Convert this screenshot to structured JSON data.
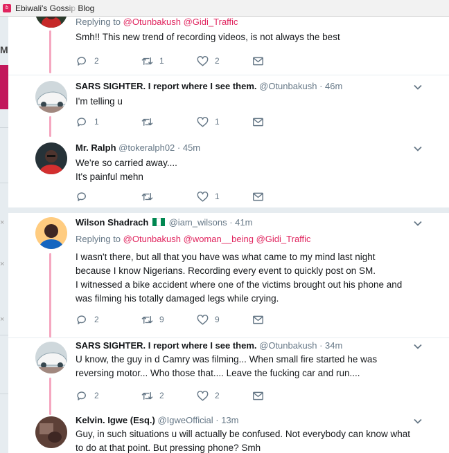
{
  "browser": {
    "tab_title": "Ebiwali's Gossip Blog"
  },
  "left_strip": {
    "letter": "M",
    "close_glyph": "×"
  },
  "tweets": [
    {
      "replying_label": "Replying to",
      "mentions": [
        "@Otunbakush",
        "@Gidi_Traffic"
      ],
      "text": [
        "Smh!! This new trend of recording videos, is not always the best"
      ],
      "reply_count": "2",
      "retweet_count": "1",
      "like_count": "2"
    },
    {
      "name": "SARS SIGHTER. I report where I see them.",
      "handle": "@Otunbakush",
      "time": "· 46m",
      "text": [
        "I'm telling u"
      ],
      "reply_count": "1",
      "retweet_count": "",
      "like_count": "1"
    },
    {
      "name": "Mr. Ralph",
      "handle": "@tokeralph02",
      "time": "· 45m",
      "text": [
        "We're so carried away....",
        "It's painful mehn"
      ],
      "reply_count": "",
      "retweet_count": "",
      "like_count": "1"
    },
    {
      "name": "Wilson Shadrach",
      "handle": "@iam_wilsons",
      "time": "· 41m",
      "replying_label": "Replying to",
      "mentions": [
        "@Otunbakush",
        "@woman__being",
        "@Gidi_Traffic"
      ],
      "text": [
        "I wasn't there, but all that you have was what came to my mind last night",
        "because I know Nigerians. Recording every event to quickly post on SM.",
        "I witnessed a bike accident where one of the victims brought out his phone and",
        "was filming his totally damaged legs while crying."
      ],
      "reply_count": "2",
      "retweet_count": "9",
      "like_count": "9"
    },
    {
      "name": "SARS SIGHTER. I report where I see them.",
      "handle": "@Otunbakush",
      "time": "· 34m",
      "text": [
        "U know, the guy in d Camry was filming... When small fire started he was",
        "reversing motor... Who those that.... Leave the fucking car and run...."
      ],
      "reply_count": "2",
      "retweet_count": "2",
      "like_count": "2"
    },
    {
      "name": "Kelvin. Igwe (Esq.)",
      "handle": "@IgweOfficial",
      "time": "· 13m",
      "text": [
        "Guy, in such situations u will actually be confused. Not everybody can know what",
        "to do at that point. But pressing phone? Smh"
      ]
    }
  ],
  "colors": {
    "accent": "#e0245e",
    "thread_line": "#f5a7c0",
    "secondary_text": "#657786",
    "icon": "#657786",
    "flag_green": "#008751"
  },
  "icons": [
    "reply-icon",
    "retweet-icon",
    "like-icon",
    "message-icon",
    "chevron-down-icon",
    "nigeria-flag-icon"
  ]
}
